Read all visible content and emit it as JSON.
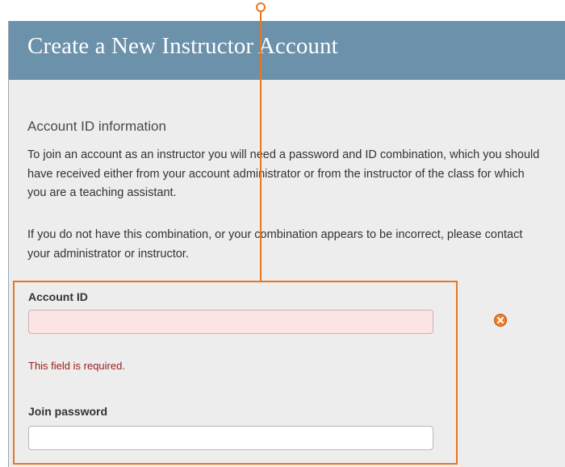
{
  "header": {
    "title": "Create a New Instructor Account"
  },
  "section": {
    "heading": "Account ID information",
    "paragraphs": [
      "To join an account as an instructor you will need a password and ID combination, which you should have received either from your account administrator or from the instructor of the class for which you are a teaching assistant.",
      "If you do not have this combination, or your combination appears to be incorrect, please contact your administrator or instructor."
    ]
  },
  "fields": {
    "account_id": {
      "label": "Account ID",
      "value": "",
      "error": "This field is required."
    },
    "join_password": {
      "label": "Join password",
      "value": ""
    }
  },
  "colors": {
    "header_bg": "#6b91ab",
    "panel_bg": "#ededed",
    "callout": "#e87722",
    "error_text": "#9b1b1b",
    "error_field_bg": "#fde4e4"
  },
  "icons": {
    "error": "error-x-circle-icon"
  }
}
